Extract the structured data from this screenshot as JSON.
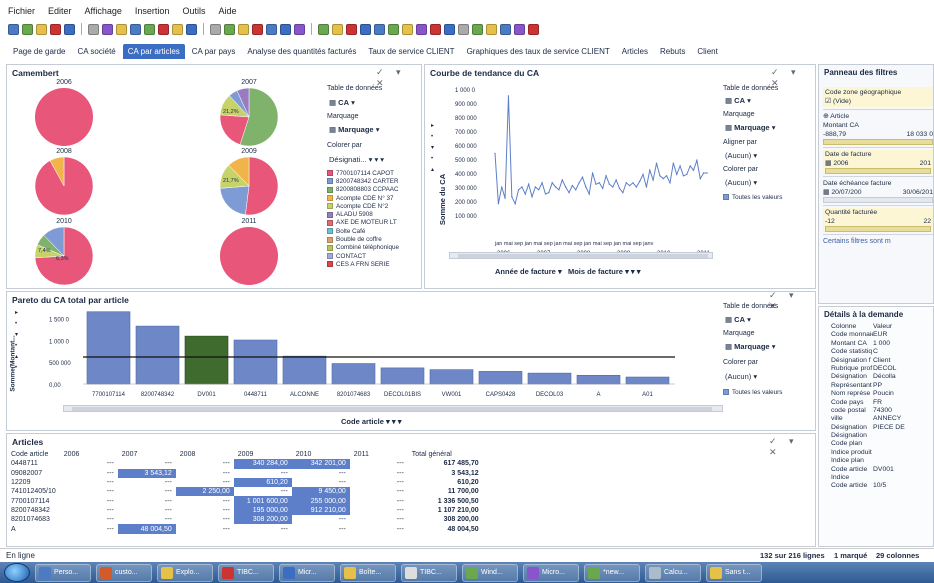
{
  "menu": [
    "Fichier",
    "Editer",
    "Affichage",
    "Insertion",
    "Outils",
    "Aide"
  ],
  "tabs": [
    {
      "label": "Page de garde",
      "active": false
    },
    {
      "label": "CA société",
      "active": false
    },
    {
      "label": "CA par articles",
      "active": true
    },
    {
      "label": "CA par pays",
      "active": false
    },
    {
      "label": "Analyse des quantités facturés",
      "active": false
    },
    {
      "label": "Taux de service CLIENT",
      "active": false
    },
    {
      "label": "Graphiques des taux de service CLIENT",
      "active": false
    },
    {
      "label": "Articles",
      "active": false
    },
    {
      "label": "Rebuts",
      "active": false
    },
    {
      "label": "Client",
      "active": false
    }
  ],
  "camembert": {
    "title": "Camembert",
    "years": [
      "2006",
      "2007",
      "2008",
      "2009",
      "2010",
      "2011"
    ],
    "pct_labels": {
      "p2007": "21,2%",
      "p2009": "21,7%",
      "p2010a": "7,4%",
      "p2010b": "6,3%"
    },
    "table_label": "Table de données",
    "table_value": "CA",
    "marquage_label": "Marquage",
    "marquage_value": "Marquage",
    "colorer_label": "Colorer par",
    "colorer_value": "Désignati...",
    "legend": [
      {
        "label": "7700107114 CAPOT",
        "color": "#e8567a"
      },
      {
        "label": "8200748342 CARTER",
        "color": "#7f9bd6"
      },
      {
        "label": "8200808803 CCPAAC",
        "color": "#7fb26a"
      },
      {
        "label": "Acompte CDE N° 37",
        "color": "#f0b44a"
      },
      {
        "label": "Acompte CDE N°2",
        "color": "#c6d36a"
      },
      {
        "label": "ALADU 5908",
        "color": "#9a7bc2"
      },
      {
        "label": "AXE DE MOTEUR LT",
        "color": "#e06b6b"
      },
      {
        "label": "Bolte Café",
        "color": "#6ec0c9"
      },
      {
        "label": "Bouble de coffre",
        "color": "#d9a36b"
      },
      {
        "label": "Combiné téléphonique",
        "color": "#b2c95a"
      },
      {
        "label": "CONTACT",
        "color": "#a8a8d8"
      },
      {
        "label": "CES A FRN SERIE",
        "color": "#d84a4a"
      }
    ]
  },
  "courbe": {
    "title": "Courbe de tendance du CA",
    "ylabel": "Somme du CA",
    "yticks": [
      "1 000 0",
      "900 000",
      "800 000",
      "700 000",
      "600 000",
      "500 000",
      "400 000",
      "300 000",
      "200 000",
      "100 000"
    ],
    "xticks": [
      "2006",
      "2007",
      "2008",
      "2009",
      "2010",
      "2011"
    ],
    "month_row": "jan mai sep jan mai sep jan mai sep jan mai sep jan mai sep janv",
    "x_title_a": "Année de facture",
    "x_title_b": "Mois de facture",
    "table_label": "Table de données",
    "table_value": "CA",
    "marquage_label": "Marquage",
    "marquage_value": "Marquage",
    "aligner_label": "Aligner par",
    "aligner_value": "(Aucun)",
    "colorer_label": "Colorer par",
    "colorer_value": "(Aucun)",
    "legend": "Toutes les valeurs"
  },
  "pareto": {
    "title": "Pareto du CA total par article",
    "ylabel": "Somme(Montant...",
    "yticks": [
      "1 500 0",
      "1 000 0",
      "500 000",
      "0,00"
    ],
    "x_title": "Code article",
    "table_label": "Table de données",
    "table_value": "CA",
    "marquage_label": "Marquage",
    "marquage_value": "Marquage",
    "colorer_label": "Colorer par",
    "colorer_value": "(Aucun)",
    "legend": "Toutes les valeurs"
  },
  "articles": {
    "title": "Articles",
    "headers": [
      "Code article",
      "2006",
      "2007",
      "2008",
      "2009",
      "2010",
      "2011",
      "Total général"
    ],
    "rows": [
      {
        "code": "0448711",
        "c": [
          "---",
          "---",
          "---",
          "340 284,00",
          "342 201,00",
          "---"
        ],
        "total": "617 485,70"
      },
      {
        "code": "09082007",
        "c": [
          "---",
          "3 543,12",
          "---",
          "---",
          "---",
          "---"
        ],
        "total": "3 543,12"
      },
      {
        "code": "12209",
        "c": [
          "---",
          "---",
          "---",
          "610,20",
          "---",
          "---"
        ],
        "total": "610,20"
      },
      {
        "code": "741012405/10",
        "c": [
          "---",
          "---",
          "2 250,00",
          "---",
          "9 450,00",
          "---"
        ],
        "total": "11 700,00"
      },
      {
        "code": "7700107114",
        "c": [
          "---",
          "---",
          "---",
          "1 001 600,00",
          "255 000,00",
          "---"
        ],
        "total": "1 336 500,50"
      },
      {
        "code": "8200748342",
        "c": [
          "---",
          "---",
          "---",
          "195 000,00",
          "912 210,00",
          "---"
        ],
        "total": "1 107 210,00"
      },
      {
        "code": "8201074683",
        "c": [
          "---",
          "---",
          "---",
          "308 200,00",
          "---",
          "---"
        ],
        "total": "308 200,00"
      },
      {
        "code": "A",
        "c": [
          "---",
          "48 004,50",
          "---",
          "---",
          "---",
          "---"
        ],
        "total": "48 004,50"
      }
    ]
  },
  "filters": {
    "title": "Panneau des filtres",
    "zone_label": "Code zone géographique",
    "zone_value": "(Vide)",
    "article_label": "Article",
    "montant_label": "Montant CA",
    "montant_min": "-888,79",
    "montant_max": "18 033 0",
    "date_label": "Date de facture",
    "date_min": "2006",
    "date_max": "201",
    "echeance_label": "Date échéance facture",
    "echeance_min": "20/07/200",
    "echeance_max": "30/06/201",
    "qte_label": "Quantité facturée",
    "qte_min": "-12",
    "qte_max": "22",
    "note": "Certains filtres sont m"
  },
  "details": {
    "title": "Détails à la demande",
    "rows": [
      [
        "Colonne",
        "Valeur"
      ],
      [
        "Code monnaie",
        "EUR"
      ],
      [
        "Montant CA",
        "1 000"
      ],
      [
        "Code statistiq",
        "C"
      ],
      [
        "Désignation f",
        "Client"
      ],
      [
        "Rubrique prof",
        "DECOL"
      ],
      [
        "Désignation",
        "Décolla"
      ],
      [
        "Représentant",
        "PP"
      ],
      [
        "Nom représe",
        "Poucin"
      ],
      [
        "Code pays",
        "FR"
      ],
      [
        "code postal",
        "74300"
      ],
      [
        "ville",
        "ANNECY"
      ],
      [
        "Désignation",
        "PIECE DE"
      ],
      [
        "Désignation",
        ""
      ],
      [
        "Code plan",
        ""
      ],
      [
        "Indice produit",
        ""
      ],
      [
        "Indice plan",
        ""
      ],
      [
        "Code article",
        "DV001"
      ],
      [
        "Indice",
        ""
      ],
      [
        "Code article",
        "10/5"
      ]
    ]
  },
  "status": {
    "left": "En ligne",
    "rows": "132 sur 216 lignes",
    "marked": "1 marqué",
    "cols": "29 colonnes"
  },
  "taskbar": [
    {
      "label": "Perso...",
      "color": "#4a7bc4"
    },
    {
      "label": "custo...",
      "color": "#d35a2a"
    },
    {
      "label": "Explo...",
      "color": "#e6c14a"
    },
    {
      "label": "TIBC...",
      "color": "#cc3333"
    },
    {
      "label": "Micr...",
      "color": "#3b6dc2"
    },
    {
      "label": "Boîte...",
      "color": "#e6c14a"
    },
    {
      "label": "TIBC...",
      "color": "#dddddd"
    },
    {
      "label": "Wind...",
      "color": "#6aa84f"
    },
    {
      "label": "Micro...",
      "color": "#8855cc"
    },
    {
      "label": "*new...",
      "color": "#6aa84f"
    },
    {
      "label": "Calcu...",
      "color": "#aabbcc"
    },
    {
      "label": "Sans t...",
      "color": "#e6c14a"
    }
  ],
  "chart_data": [
    {
      "type": "pie",
      "title": "Camembert",
      "pies": [
        {
          "year": "2006",
          "slices": [
            {
              "label": "7700107114 CAPOT",
              "value": 100
            }
          ]
        },
        {
          "year": "2007",
          "slices": [
            {
              "label": "8200808803 CCPAAC",
              "value": 55
            },
            {
              "label": "7700107114 CAPOT",
              "value": 21.2
            },
            {
              "label": "Acompte CDE N°2",
              "value": 12
            },
            {
              "label": "8200748342 CARTER",
              "value": 5
            },
            {
              "label": "ALADU 5908",
              "value": 6.8
            }
          ]
        },
        {
          "year": "2008",
          "slices": [
            {
              "label": "7700107114 CAPOT",
              "value": 92
            },
            {
              "label": "Acompte CDE N° 37",
              "value": 8
            }
          ]
        },
        {
          "year": "2009",
          "slices": [
            {
              "label": "7700107114 CAPOT",
              "value": 52
            },
            {
              "label": "8200748342 CARTER",
              "value": 21.7
            },
            {
              "label": "Acompte CDE N°2",
              "value": 14
            },
            {
              "label": "Acompte CDE N° 37",
              "value": 12.3
            }
          ]
        },
        {
          "year": "2010",
          "slices": [
            {
              "label": "7700107114 CAPOT",
              "value": 74
            },
            {
              "label": "Acompte CDE N°2",
              "value": 7.4
            },
            {
              "label": "8200808803 CCPAAC",
              "value": 6.3
            },
            {
              "label": "8200748342 CARTER",
              "value": 12.3
            }
          ]
        },
        {
          "year": "2011",
          "slices": [
            {
              "label": "7700107114 CAPOT",
              "value": 100
            }
          ]
        }
      ]
    },
    {
      "type": "line",
      "title": "Courbe de tendance du CA",
      "ylabel": "Somme du CA",
      "ylim": [
        0,
        1000000
      ],
      "values": [
        540000,
        180000,
        300000,
        220000,
        950000,
        230000,
        180000,
        280000,
        300000,
        250000,
        320000,
        230000,
        300000,
        280000,
        330000,
        250000,
        260000,
        330000,
        300000,
        280000,
        350000,
        300000,
        260000,
        310000,
        280000,
        330000,
        370000,
        300000,
        250000,
        400000,
        320000,
        330000,
        290000,
        380000,
        320000,
        300000,
        350000,
        290000,
        260000,
        330000,
        310000,
        330000,
        300000,
        340000,
        390000,
        300000,
        420000,
        350000,
        470000,
        380000,
        360000,
        380000,
        330000,
        470000,
        390000,
        450000,
        380000,
        390000,
        450000,
        420000,
        490000,
        360000,
        400000,
        400000
      ]
    },
    {
      "type": "bar",
      "title": "Pareto du CA total par article",
      "ylabel": "Somme(Montant...",
      "xlabel": "Code article",
      "ylim": [
        0,
        1700000
      ],
      "categories": [
        "7700107114",
        "8200748342",
        "DV001",
        "0448711",
        "ALCONNE",
        "8201074683",
        "DECOL01BIS",
        "VW001",
        "CAPS0428",
        "DECOL03",
        "A",
        "A01"
      ],
      "values": [
        1660000,
        1330000,
        1100000,
        1010000,
        640000,
        470000,
        370000,
        330000,
        290000,
        250000,
        200000,
        160000
      ],
      "highlight": "DV001",
      "reference_line": 620000
    }
  ]
}
